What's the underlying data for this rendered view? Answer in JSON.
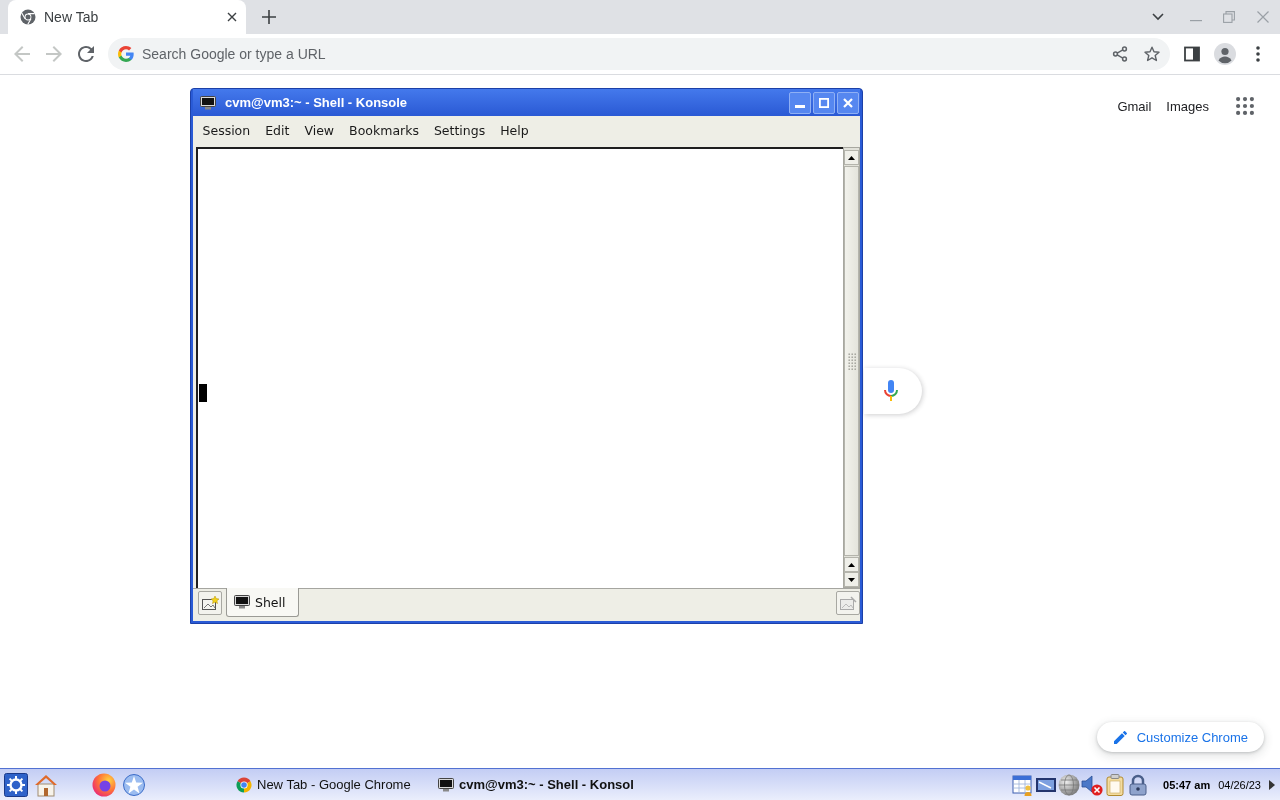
{
  "browser": {
    "tabs": [
      {
        "title": "New Tab",
        "selected": true
      }
    ],
    "back": {
      "disabled": true
    },
    "forward": {
      "disabled": true
    },
    "omnibox": {
      "placeholder": "Search Google or type a URL"
    }
  },
  "new_tab_page": {
    "links": [
      "Gmail",
      "Images"
    ],
    "customize_button": "Customize Chrome"
  },
  "konsole": {
    "title": "cvm@vm3:~ - Shell - Konsole",
    "menu": [
      "Session",
      "Edit",
      "View",
      "Bookmarks",
      "Settings",
      "Help"
    ],
    "tabs": [
      {
        "label": "Shell",
        "selected": true
      }
    ]
  },
  "taskbar": {
    "tasks": [
      {
        "kind": "browser",
        "label": "New Tab - Google Chrome",
        "selected": false
      },
      {
        "kind": "terminal",
        "label": "cvm@vm3:~ - Shell - Konsol",
        "selected": true
      }
    ],
    "clock": "05:47 am",
    "date": "04/26/23"
  }
}
